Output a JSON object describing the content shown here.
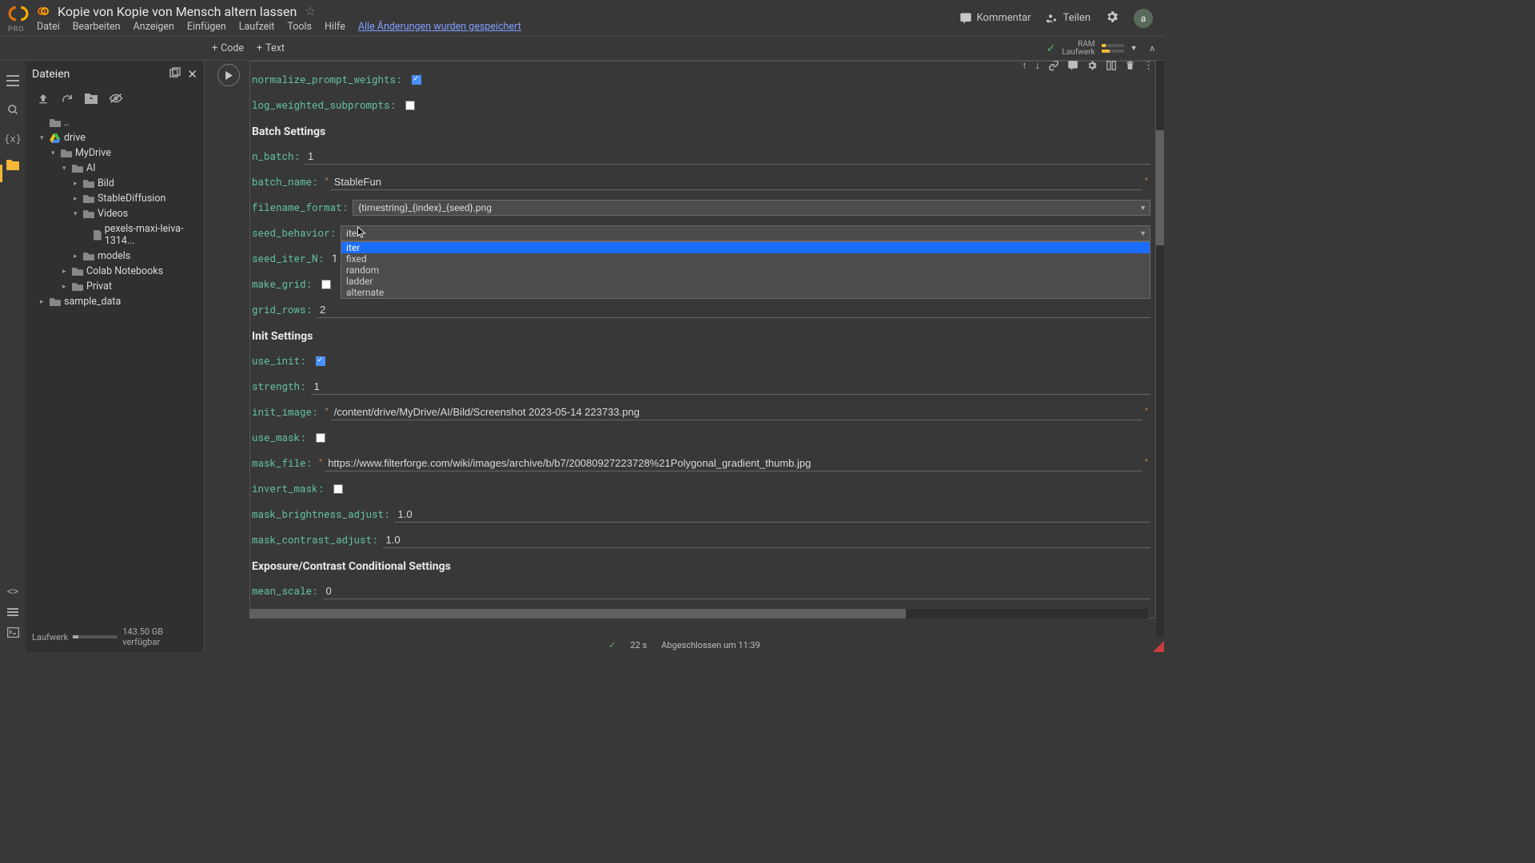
{
  "header": {
    "pro": "PRO",
    "title": "Kopie von Kopie von Mensch altern lassen",
    "menu": [
      "Datei",
      "Bearbeiten",
      "Anzeigen",
      "Einfügen",
      "Laufzeit",
      "Tools",
      "Hilfe"
    ],
    "saved": "Alle Änderungen wurden gespeichert",
    "comment": "Kommentar",
    "share": "Teilen",
    "avatar": "a"
  },
  "subbar": {
    "code": "Code",
    "text": "Text",
    "resources": {
      "ram": "RAM",
      "disk": "Laufwerk",
      "ram_pct": 18,
      "disk_pct": 36
    }
  },
  "files": {
    "title": "Dateien",
    "disk_label": "Laufwerk",
    "disk_free": "143.50 GB verfügbar",
    "disk_used_pct": 12,
    "tree": {
      "dotdot": "..",
      "drive": "drive",
      "mydrive": "MyDrive",
      "ai": "AI",
      "bild": "Bild",
      "sd": "StableDiffusion",
      "videos": "Videos",
      "pexels": "pexels-maxi-leiva-1314...",
      "models": "models",
      "colab": "Colab Notebooks",
      "privat": "Privat",
      "sample": "sample_data"
    }
  },
  "cell": {
    "form": {
      "normalize_prompt_weights": {
        "label": "normalize_prompt_weights:",
        "checked": true
      },
      "log_weighted_subprompts": {
        "label": "log_weighted_subprompts:",
        "checked": false
      },
      "batch_heading": "Batch Settings",
      "n_batch": {
        "label": "n_batch:",
        "value": "1"
      },
      "batch_name": {
        "label": "batch_name:",
        "value": "StableFun"
      },
      "filename_format": {
        "label": "filename_format:",
        "value": "{timestring}_{index}_{seed}.png"
      },
      "seed_behavior": {
        "label": "seed_behavior:",
        "value": "iter",
        "options": [
          "iter",
          "fixed",
          "random",
          "ladder",
          "alternate"
        ],
        "highlight": "iter"
      },
      "seed_iter_n": {
        "label": "seed_iter_N:",
        "value": "1"
      },
      "make_grid": {
        "label": "make_grid:",
        "checked": false
      },
      "grid_rows": {
        "label": "grid_rows:",
        "value": "2"
      },
      "init_heading": "Init Settings",
      "use_init": {
        "label": "use_init:",
        "checked": true
      },
      "strength": {
        "label": "strength:",
        "value": "1"
      },
      "init_image": {
        "label": "init_image:",
        "value": "/content/drive/MyDrive/AI/Bild/Screenshot 2023-05-14 223733.png"
      },
      "use_mask": {
        "label": "use_mask:",
        "checked": false
      },
      "mask_file": {
        "label": "mask_file:",
        "value": "https://www.filterforge.com/wiki/images/archive/b/b7/20080927223728%21Polygonal_gradient_thumb.jpg"
      },
      "invert_mask": {
        "label": "invert_mask:",
        "checked": false
      },
      "mask_brightness_adjust": {
        "label": "mask_brightness_adjust:",
        "value": "1.0"
      },
      "mask_contrast_adjust": {
        "label": "mask_contrast_adjust:",
        "value": "1.0"
      },
      "exposure_heading": "Exposure/Contrast Conditional Settings",
      "mean_scale": {
        "label": "mean_scale:",
        "value": "0"
      }
    }
  },
  "status": {
    "elapsed": "22 s",
    "done": "Abgeschlossen um 11:39"
  }
}
